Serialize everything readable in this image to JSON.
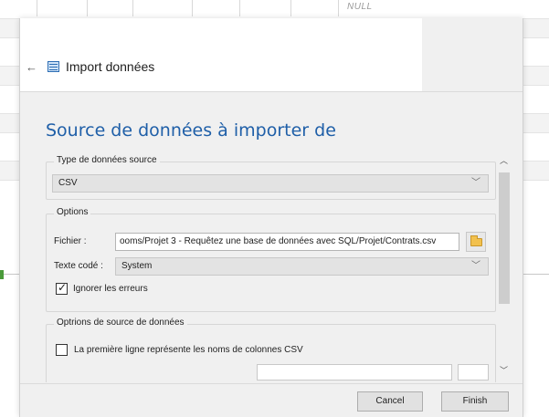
{
  "background": {
    "null_cell": "NULL"
  },
  "dialog": {
    "title": "Import données",
    "page_title": "Source de données à importer de",
    "source_type": {
      "legend": "Type de données source",
      "selected": "CSV"
    },
    "options": {
      "legend": "Options",
      "file_label": "Fichier :",
      "file_value": "ooms/Projet 3 - Requêtez une base de données avec SQL/Projet/Contrats.csv",
      "encoding_label": "Texte codé :",
      "encoding_value": "System",
      "ignore_errors_label": "Ignorer les erreurs",
      "ignore_errors_checked": true
    },
    "source_options": {
      "legend": "Optrions de source de données",
      "first_line_label": "La première ligne représente les noms de colonnes CSV",
      "first_line_checked": false
    },
    "buttons": {
      "cancel": "Cancel",
      "finish": "Finish"
    }
  },
  "colors": {
    "accent": "#1f5fa8",
    "dialog_bg": "#f0f0f0"
  }
}
